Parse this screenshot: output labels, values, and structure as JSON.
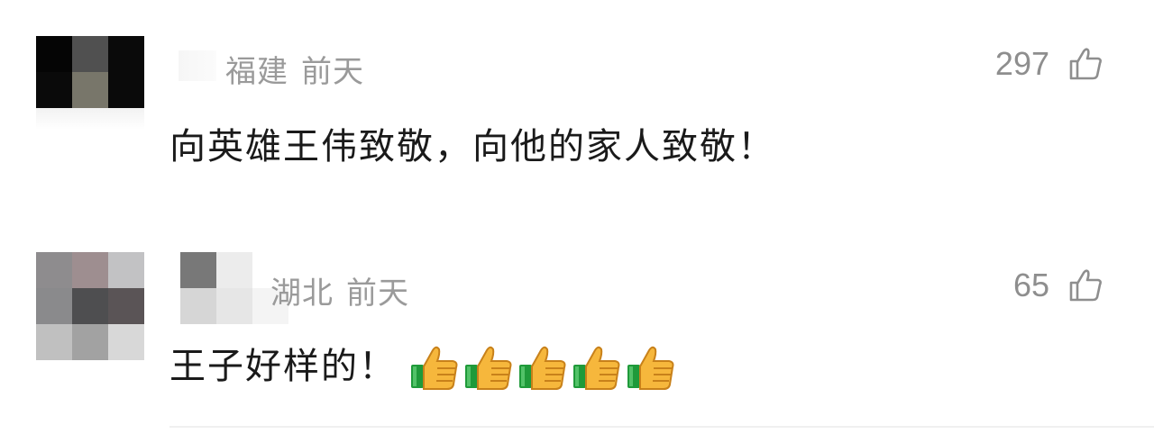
{
  "comments": [
    {
      "region": "福建",
      "time": "前天",
      "likes": "297",
      "text": "向英雄王伟致敬，向他的家人致敬！",
      "avatar_colors": [
        "#050505",
        "#505050",
        "#0a0a0a",
        "#0a0a0a",
        "#78766a",
        "#0a0a0a"
      ],
      "emoji_count": 0
    },
    {
      "region": "湖北",
      "time": "前天",
      "likes": "65",
      "text": "王子好样的！",
      "avatar_colors": [
        "#8e8c8e",
        "#9e8e90",
        "#c2c2c4",
        "#8a8a8c",
        "#4e4e50",
        "#5a5456",
        "#c0c0c0",
        "#a2a2a2",
        "#d8d8d8"
      ],
      "name_blur_colors": [
        "#787878",
        "#ececec",
        "#ffffff",
        "#d6d6d6",
        "#e6e6e6",
        "#f4f4f4"
      ],
      "emoji": "thumbs-up",
      "emoji_count": 5
    }
  ],
  "colors": {
    "meta": "#9a9a9a",
    "text": "#1a1a1a",
    "like": "#8e8e8e"
  }
}
